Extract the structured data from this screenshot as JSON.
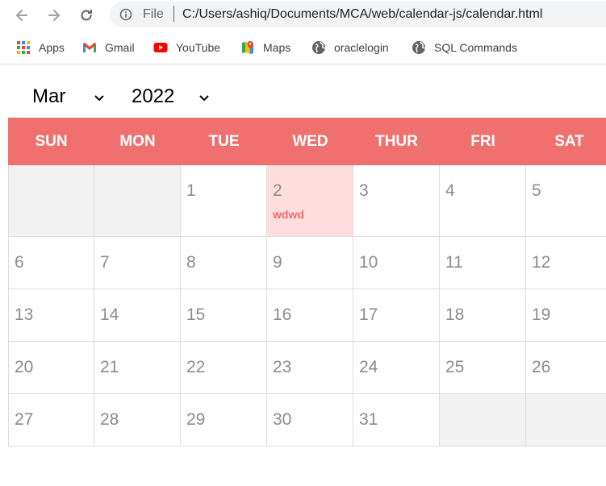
{
  "browser": {
    "url_scheme": "File",
    "url": "C:/Users/ashiq/Documents/MCA/web/calendar-js/calendar.html",
    "icons": [
      "back-arrow-icon",
      "forward-arrow-icon",
      "reload-icon",
      "info-icon"
    ]
  },
  "bookmarks": [
    {
      "label": "Apps",
      "icon": "apps-grid-icon"
    },
    {
      "label": "Gmail",
      "icon": "gmail-icon"
    },
    {
      "label": "YouTube",
      "icon": "youtube-icon"
    },
    {
      "label": "Maps",
      "icon": "maps-icon"
    },
    {
      "label": "oraclelogin",
      "icon": "globe-icon"
    },
    {
      "label": "SQL Commands",
      "icon": "globe-icon"
    }
  ],
  "controls": {
    "month": "Mar",
    "year": "2022"
  },
  "calendar": {
    "header_color": "#f07070",
    "weekdays": [
      "SUN",
      "MON",
      "TUE",
      "WED",
      "THUR",
      "FRI",
      "SAT"
    ],
    "weeks": [
      [
        {
          "day": ""
        },
        {
          "day": ""
        },
        {
          "day": "1"
        },
        {
          "day": "2",
          "event": "wdwd",
          "highlight": true
        },
        {
          "day": "3"
        },
        {
          "day": "4"
        },
        {
          "day": "5"
        }
      ],
      [
        {
          "day": "6"
        },
        {
          "day": "7"
        },
        {
          "day": "8"
        },
        {
          "day": "9"
        },
        {
          "day": "10"
        },
        {
          "day": "11"
        },
        {
          "day": "12"
        }
      ],
      [
        {
          "day": "13"
        },
        {
          "day": "14"
        },
        {
          "day": "15"
        },
        {
          "day": "16"
        },
        {
          "day": "17"
        },
        {
          "day": "18"
        },
        {
          "day": "19"
        }
      ],
      [
        {
          "day": "20"
        },
        {
          "day": "21"
        },
        {
          "day": "22"
        },
        {
          "day": "23"
        },
        {
          "day": "24"
        },
        {
          "day": "25"
        },
        {
          "day": "26"
        }
      ],
      [
        {
          "day": "27"
        },
        {
          "day": "28"
        },
        {
          "day": "29"
        },
        {
          "day": "30"
        },
        {
          "day": "31"
        },
        {
          "day": ""
        },
        {
          "day": ""
        }
      ]
    ]
  }
}
